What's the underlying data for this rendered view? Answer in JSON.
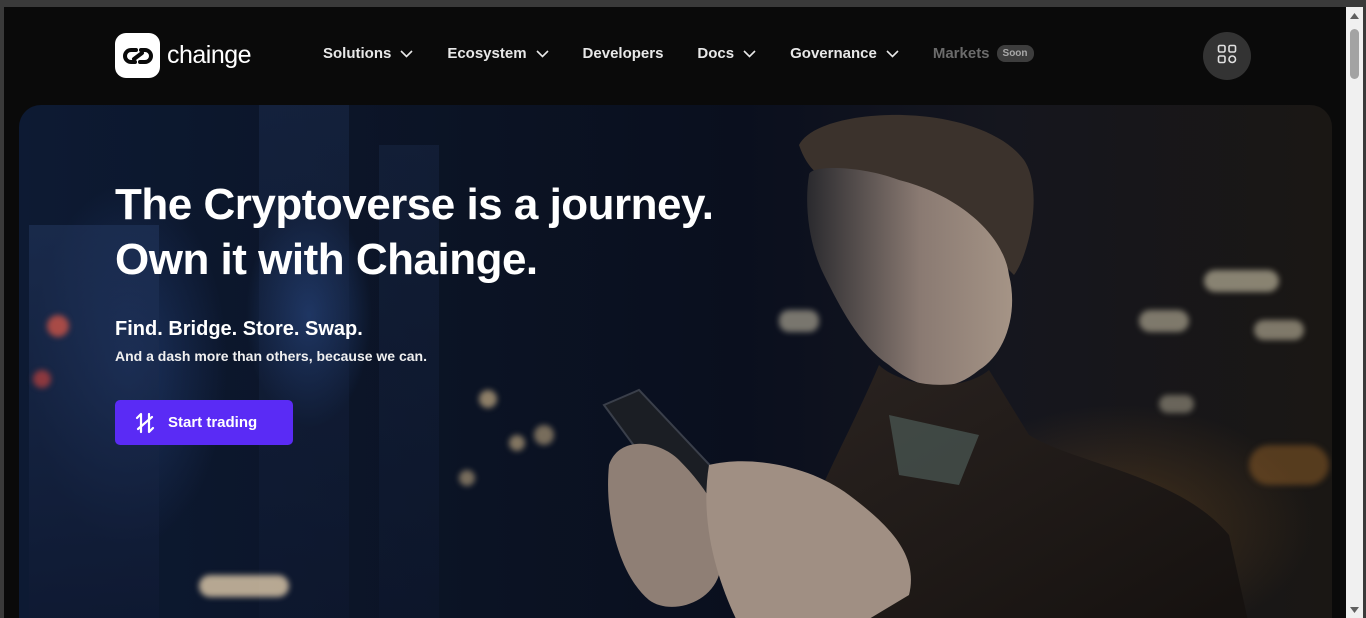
{
  "brand": {
    "name": "chainge"
  },
  "nav": [
    {
      "label": "Solutions",
      "has_dropdown": true
    },
    {
      "label": "Ecosystem",
      "has_dropdown": true
    },
    {
      "label": "Developers",
      "has_dropdown": false
    },
    {
      "label": "Docs",
      "has_dropdown": true
    },
    {
      "label": "Governance",
      "has_dropdown": true
    },
    {
      "label": "Markets",
      "has_dropdown": false,
      "disabled": true,
      "badge": "Soon"
    }
  ],
  "header_actions": {
    "apps_icon": "grid-icon"
  },
  "hero": {
    "headline_line1": "The Cryptoverse is a journey.",
    "headline_line2": "Own it with Chainge.",
    "subhead": "Find. Bridge. Store. Swap.",
    "tagline": "And a dash more than others, because we can.",
    "cta_label": "Start trading",
    "cta_icon": "chainge-swap-icon"
  },
  "colors": {
    "accent": "#5a2bf5",
    "background": "#0a0a0a",
    "badge_bg": "#3d3d3d"
  }
}
